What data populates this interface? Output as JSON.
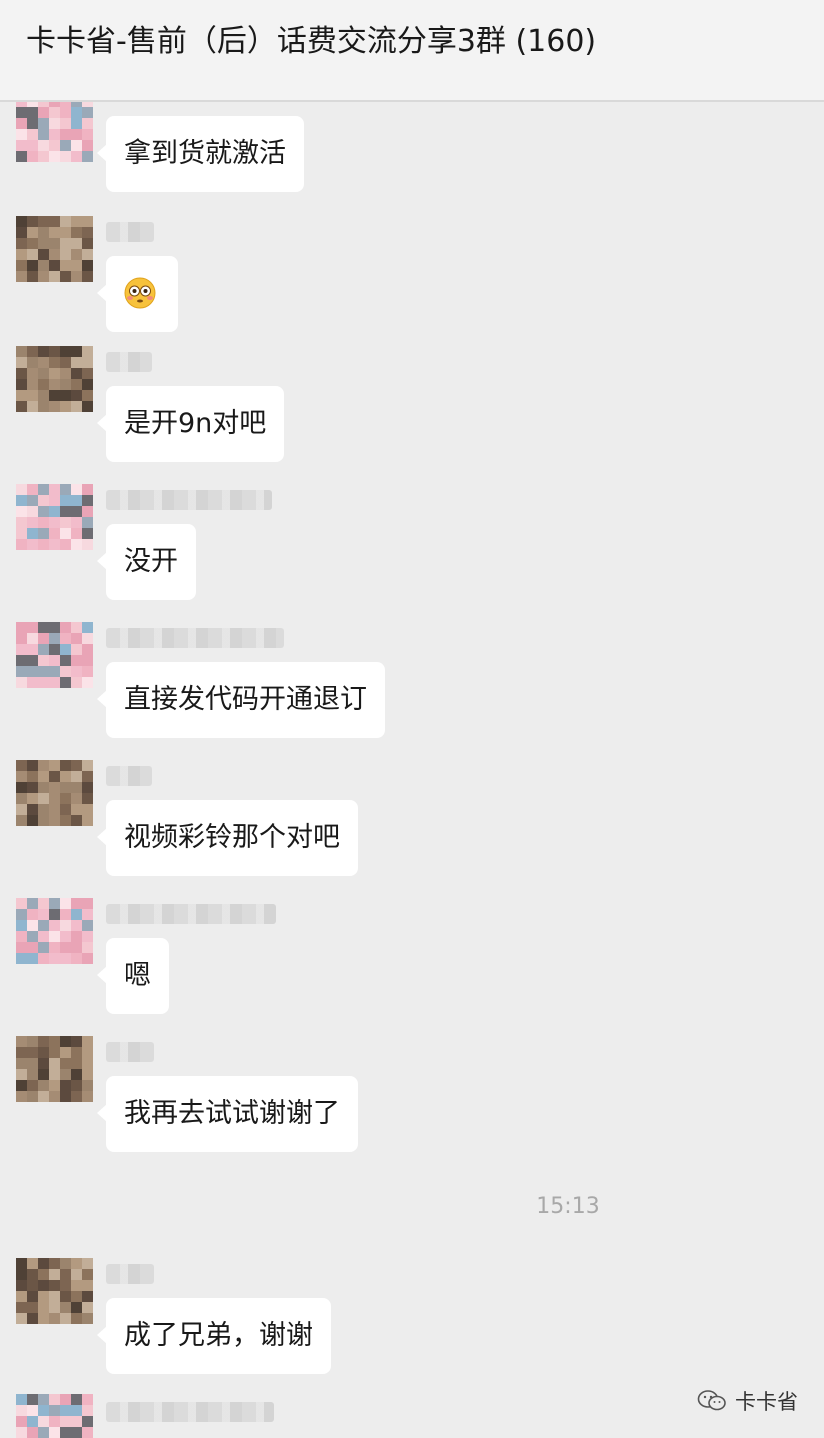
{
  "header": {
    "title": "卡卡省-售前（后）话费交流分享3群 (160)"
  },
  "messages": [
    {
      "text": "拿到货就激活",
      "avatar": "pink"
    },
    {
      "text": "",
      "emoji": "flushed-face-emoji",
      "avatar": "brown"
    },
    {
      "text": "是开9n对吧",
      "avatar": "brown"
    },
    {
      "text": "没开",
      "avatar": "pink"
    },
    {
      "text": "直接发代码开通退订",
      "avatar": "pink"
    },
    {
      "text": "视频彩铃那个对吧",
      "avatar": "brown"
    },
    {
      "text": "嗯",
      "avatar": "pink"
    },
    {
      "text": "我再去试试谢谢了",
      "avatar": "brown"
    },
    {
      "text": "成了兄弟，谢谢",
      "avatar": "brown"
    },
    {
      "text": "",
      "avatar": "pink"
    }
  ],
  "timestamp": "15:13",
  "watermark": {
    "icon": "wechat-official-account-icon",
    "label": "卡卡省"
  },
  "colors": {
    "background": "#ededed",
    "bubble": "#ffffff",
    "header": "#f3f3f3",
    "timestamp": "#a8a8a8"
  }
}
